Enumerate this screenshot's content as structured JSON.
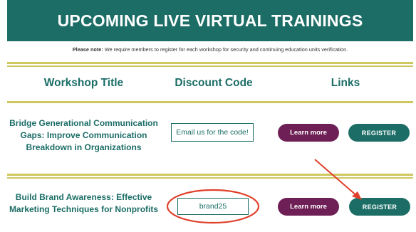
{
  "banner": {
    "title": "UPCOMING LIVE VIRTUAL TRAININGS"
  },
  "note": {
    "label": "Please note:",
    "text": " We require members to register for each workshop for security and continuing education units verification."
  },
  "table": {
    "headers": {
      "title": "Workshop Title",
      "code": "Discount Code",
      "links": "Links"
    },
    "rows": [
      {
        "title": "Bridge Generational Communication Gaps: Improve Communication Breakdown in Organizations",
        "code": "Email us for the code!",
        "learn_more": "Learn more",
        "register": "REGISTER"
      },
      {
        "title": "Build Brand Awareness: Effective Marketing Techniques for Nonprofits",
        "code": "brand25",
        "learn_more": "Learn more",
        "register": "REGISTER"
      }
    ]
  },
  "colors": {
    "teal": "#1b6d66",
    "plum": "#6e1f55",
    "gold_rule": "#cfc75f",
    "annotation_red": "#e0402a"
  }
}
